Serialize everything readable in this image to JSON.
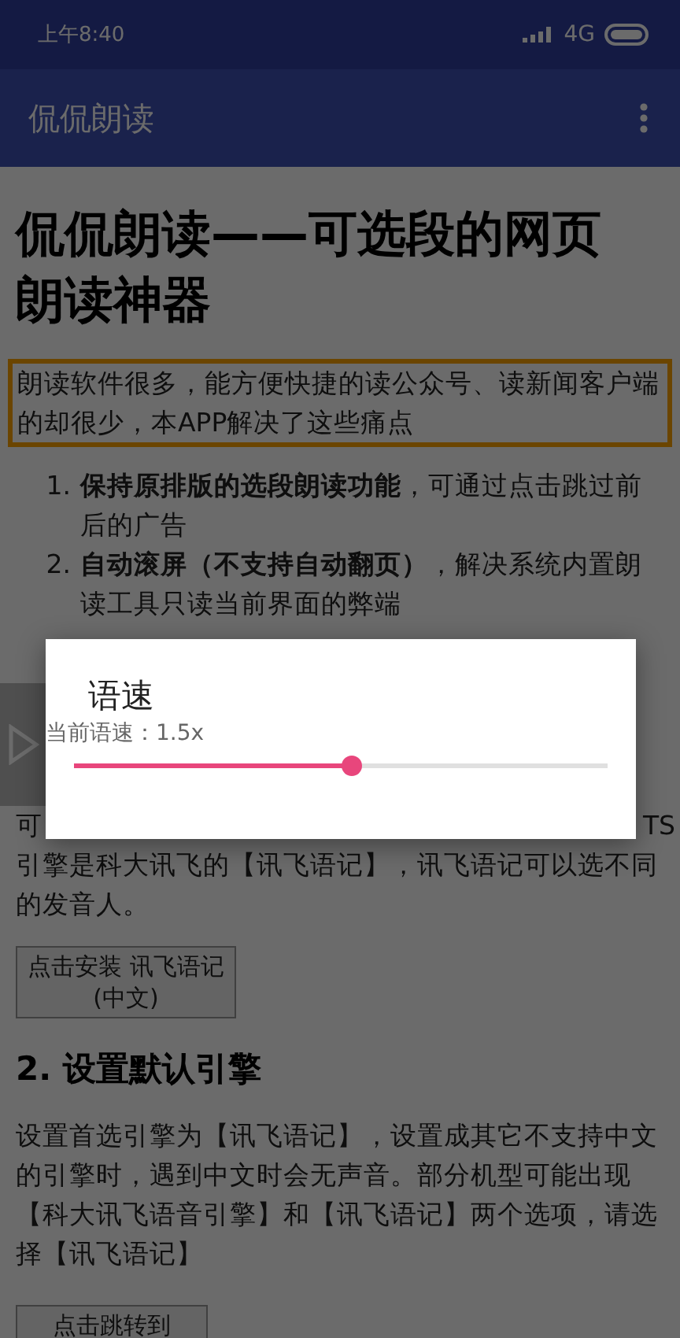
{
  "status_bar": {
    "time": "上午8:40",
    "network": "4G"
  },
  "app_bar": {
    "title": "侃侃朗读"
  },
  "article": {
    "title": "侃侃朗读——可选段的网页朗读神器",
    "intro": "朗读软件很多，能方便快捷的读公众号、读新闻客户端的却很少，本APP解决了这些痛点",
    "features": [
      {
        "number": "1.",
        "text": "**保持原排版的选段朗读功能**，可通过点击跳过前后的广告"
      },
      {
        "number": "2.",
        "text": "**自动滚屏（不支持自动翻页）**，解决系统内置朗读工具只读当前界面的弊端"
      }
    ],
    "covered_line": [
      "可",
      "TS"
    ],
    "engine_text": "引擎是科大讯飞的【讯飞语记】，讯飞语记可以选不同的发音人。",
    "install_button": "点击安装 讯飞语记(中文)",
    "section_heading": "2. 设置默认引擎",
    "section_text": "设置首选引擎为【讯飞语记】，设置成其它不支持中文的引擎时，遇到中文时会无声音。部分机型可能出现【科大讯飞语音引擎】和【讯飞语记】两个选项，请选择【讯飞语记】",
    "settings_button": "点击跳转到"
  },
  "dialog": {
    "title": "语速",
    "reading": "当前语速：1.5x",
    "slider": {
      "level": 0.5
    }
  }
}
